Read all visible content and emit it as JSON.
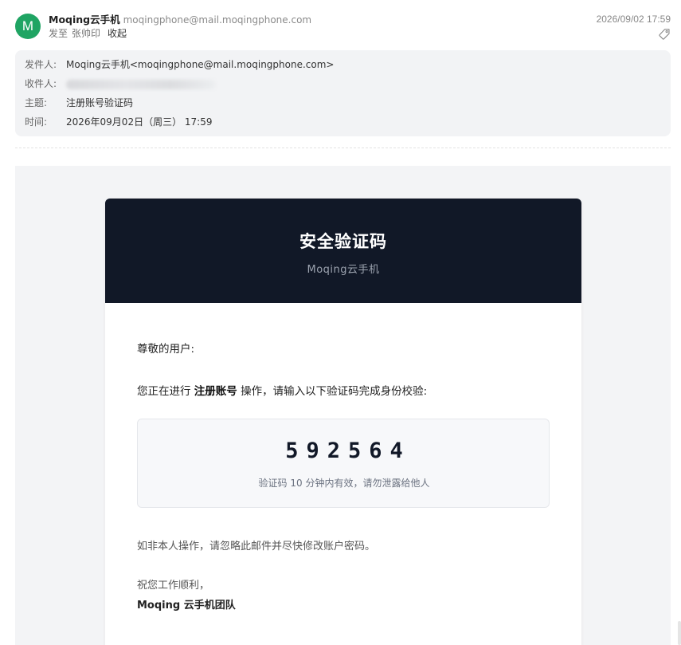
{
  "header": {
    "avatar_letter": "M",
    "sender_name": "Moqing云手机",
    "sender_email": "moqingphone@mail.moqingphone.com",
    "to_prefix": "发至",
    "to_name": "张帅印",
    "collapse_label": "收起",
    "datetime": "2026/09/02 17:59",
    "avatar_color": "#1fa463"
  },
  "details": {
    "from_label": "发件人:",
    "from_value": "Moqing云手机<moqingphone@mail.moqingphone.com>",
    "to_label": "收件人:",
    "subject_label": "主题:",
    "subject_value": "注册账号验证码",
    "time_label": "时间:",
    "time_value": "2026年09月02日（周三） 17:59"
  },
  "email": {
    "banner_title": "安全验证码",
    "banner_subtitle": "Moqing云手机",
    "greeting": "尊敬的用户:",
    "intro_before": "您正在进行 ",
    "intro_bold": "注册账号",
    "intro_after": " 操作，请输入以下验证码完成身份校验:",
    "code": "592564",
    "code_note": "验证码 10 分钟内有效，请勿泄露给他人",
    "warning": "如非本人操作，请忽略此邮件并尽快修改账户密码。",
    "closing": "祝您工作顺利，",
    "signature": "Moqing 云手机团队",
    "banner_color": "#111827"
  },
  "icons": {
    "tag": "tag-icon"
  }
}
